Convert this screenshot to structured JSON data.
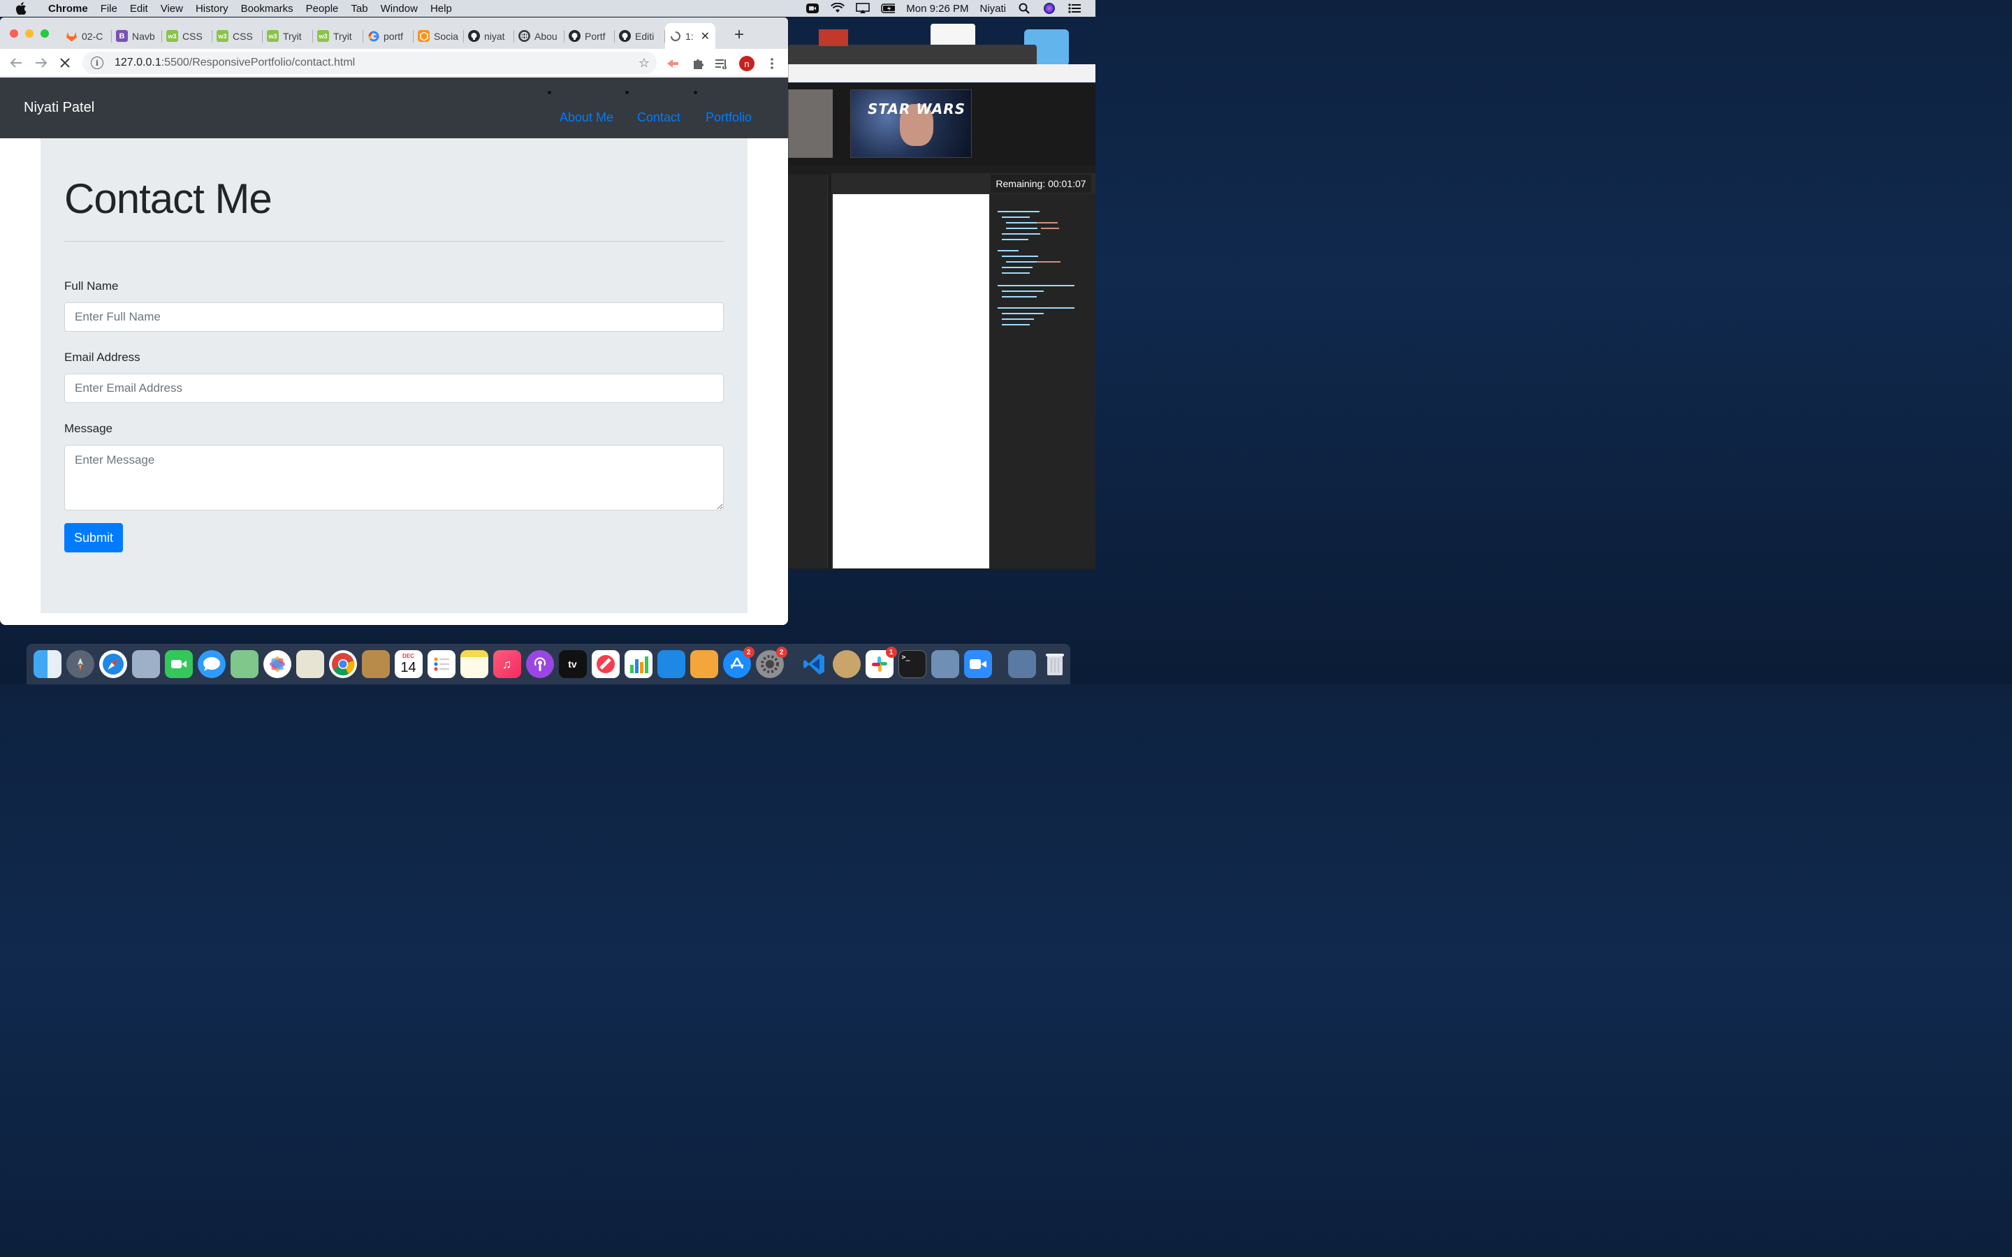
{
  "menubar": {
    "app_name": "Chrome",
    "items": [
      "File",
      "Edit",
      "View",
      "History",
      "Bookmarks",
      "People",
      "Tab",
      "Window",
      "Help"
    ],
    "clock": "Mon 9:26 PM",
    "user": "Niyati"
  },
  "browser": {
    "tabs": [
      {
        "label": "02-C",
        "icon": "gitlab-icon",
        "color": "#fc6d26"
      },
      {
        "label": "Navb",
        "icon": "bootstrap-icon",
        "color": "#7952b3"
      },
      {
        "label": "CSS",
        "icon": "w3schools-icon",
        "color": "#8bc34a"
      },
      {
        "label": "CSS",
        "icon": "w3schools-icon",
        "color": "#8bc34a"
      },
      {
        "label": "Tryit",
        "icon": "w3schools-icon",
        "color": "#8bc34a"
      },
      {
        "label": "Tryit",
        "icon": "w3schools-icon",
        "color": "#8bc34a"
      },
      {
        "label": "portf",
        "icon": "google-icon",
        "color": "#4285f4"
      },
      {
        "label": "Socia",
        "icon": "hexagon-icon",
        "color": "#f7931e"
      },
      {
        "label": "niyat",
        "icon": "github-icon",
        "color": "#24292e"
      },
      {
        "label": "Abou",
        "icon": "globe-icon",
        "color": "#3c4043"
      },
      {
        "label": "Portf",
        "icon": "github-icon",
        "color": "#24292e"
      },
      {
        "label": "Editi",
        "icon": "github-icon",
        "color": "#24292e"
      },
      {
        "label": "1:",
        "icon": "loading-icon",
        "color": "#5f6368"
      }
    ],
    "url_host": "127.0.0.1",
    "url_path": ":5500/ResponsivePortfolio/contact.html",
    "profile_initial": "n"
  },
  "site": {
    "brand": "Niyati Patel",
    "nav": [
      "About Me",
      "Contact",
      "Portfolio"
    ],
    "title": "Contact Me",
    "form": {
      "name_label": "Full Name",
      "name_placeholder": "Enter Full Name",
      "email_label": "Email Address",
      "email_placeholder": "Enter Email Address",
      "message_label": "Message",
      "message_placeholder": "Enter Message",
      "submit_label": "Submit"
    }
  },
  "background": {
    "timer_text": "Remaining: 00:01:07",
    "video_text": "STAR WARS"
  },
  "dock": {
    "calendar_month": "DEC",
    "calendar_day": "14",
    "tv_label": "tv",
    "appstore_badge": "2",
    "settings_badge": "2",
    "slack_badge": "1"
  },
  "colors": {
    "navbar_bg": "#343a40",
    "link_blue": "#007bff",
    "jumbotron_bg": "#e9ecef"
  }
}
